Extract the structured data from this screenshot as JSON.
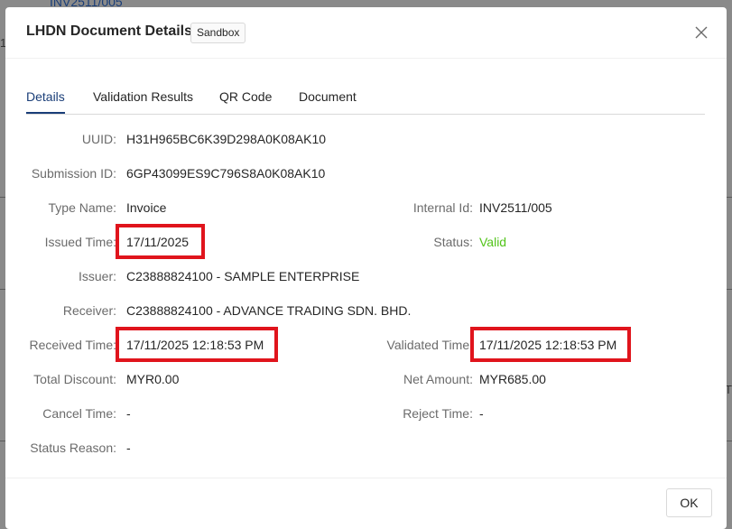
{
  "background": {
    "link_text": "INV2511/005",
    "frag_1": "1",
    "frag_2": "T"
  },
  "modal": {
    "title": "LHDN Document Details",
    "env_tag": "Sandbox",
    "close_icon": "close-icon"
  },
  "tabs": [
    {
      "label": "Details",
      "active": true
    },
    {
      "label": "Validation Results",
      "active": false
    },
    {
      "label": "QR Code",
      "active": false
    },
    {
      "label": "Document",
      "active": false
    }
  ],
  "fields": {
    "uuid": {
      "label": "UUID",
      "value": "H31H965BC6K39D298A0K08AK10"
    },
    "submission_id": {
      "label": "Submission ID",
      "value": "6GP43099ES9C796S8A0K08AK10"
    },
    "type_name": {
      "label": "Type Name",
      "value": "Invoice"
    },
    "internal_id": {
      "label": "Internal Id",
      "value": "INV2511/005"
    },
    "issued_time": {
      "label": "Issued Time",
      "value": "17/11/2025"
    },
    "status": {
      "label": "Status",
      "value": "Valid"
    },
    "issuer": {
      "label": "Issuer",
      "value": "C23888824100 - SAMPLE ENTERPRISE"
    },
    "receiver": {
      "label": "Receiver",
      "value": "C23888824100 - ADVANCE TRADING SDN. BHD."
    },
    "received_time": {
      "label": "Received Time",
      "value": "17/11/2025 12:18:53 PM"
    },
    "validated_time": {
      "label": "Validated Time",
      "value": "17/11/2025 12:18:53 PM"
    },
    "total_discount": {
      "label": "Total Discount",
      "value": "MYR0.00"
    },
    "net_amount": {
      "label": "Net Amount",
      "value": "MYR685.00"
    },
    "cancel_time": {
      "label": "Cancel Time",
      "value": "-"
    },
    "reject_time": {
      "label": "Reject Time",
      "value": "-"
    },
    "status_reason": {
      "label": "Status Reason",
      "value": "-"
    }
  },
  "colon": ":",
  "footer": {
    "ok_label": "OK"
  },
  "colors": {
    "accent": "#1a3e78",
    "valid": "#52c41a",
    "highlight": "#e0141c"
  }
}
